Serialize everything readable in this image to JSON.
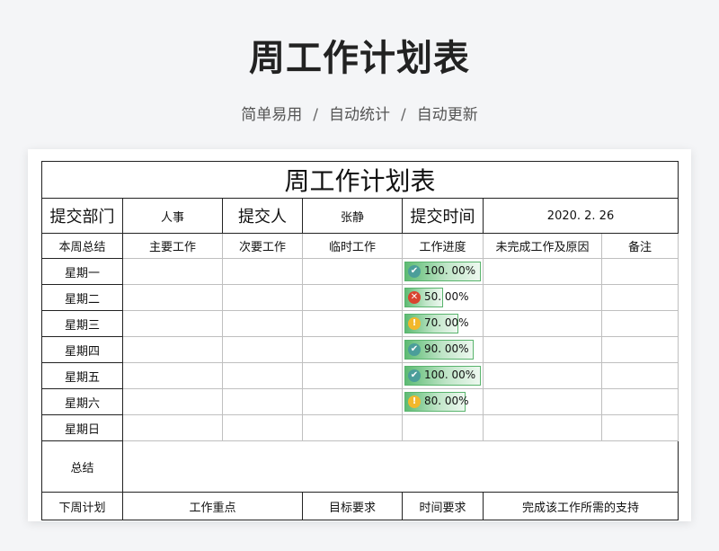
{
  "header": {
    "title": "周工作计划表",
    "tagline": [
      "简单易用",
      "自动统计",
      "自动更新"
    ],
    "separator": "/"
  },
  "sheet": {
    "title": "周工作计划表",
    "info": {
      "dept_label": "提交部门",
      "dept_value": "人事",
      "person_label": "提交人",
      "person_value": "张静",
      "time_label": "提交时间",
      "time_value": "2020. 2. 26"
    },
    "columns": [
      "本周总结",
      "主要工作",
      "次要工作",
      "临时工作",
      "工作进度",
      "未完成工作及原因",
      "备注"
    ],
    "days": [
      {
        "day": "星期一",
        "progress": 100,
        "pct_text": "100. 00%",
        "status": "ok"
      },
      {
        "day": "星期二",
        "progress": 50,
        "pct_text": "50. 00%",
        "status": "bad"
      },
      {
        "day": "星期三",
        "progress": 70,
        "pct_text": "70. 00%",
        "status": "warn"
      },
      {
        "day": "星期四",
        "progress": 90,
        "pct_text": "90. 00%",
        "status": "ok"
      },
      {
        "day": "星期五",
        "progress": 100,
        "pct_text": "100. 00%",
        "status": "ok"
      },
      {
        "day": "星期六",
        "progress": 80,
        "pct_text": "80. 00%",
        "status": "warn"
      },
      {
        "day": "星期日",
        "progress": null,
        "pct_text": "",
        "status": ""
      }
    ],
    "summary_label": "总结",
    "next_week": {
      "label": "下周计划",
      "focus": "工作重点",
      "goal": "目标要求",
      "time": "时间要求",
      "support": "完成该工作所需的支持"
    }
  },
  "icons": {
    "ok": "check-circle-icon",
    "bad": "x-circle-icon",
    "warn": "exclamation-circle-icon"
  },
  "colors": {
    "progress_fill": "#5dbb73",
    "ok": "#4b9e9a",
    "bad": "#d9442f",
    "warn": "#f2b82c"
  }
}
